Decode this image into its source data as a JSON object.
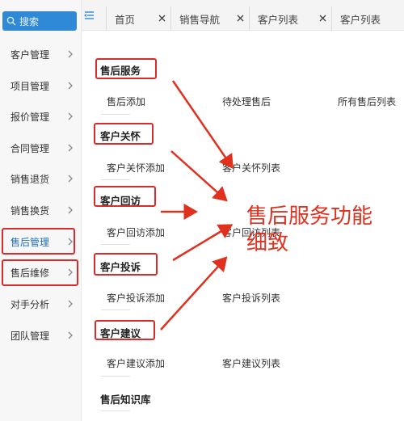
{
  "search": {
    "placeholder": "搜索"
  },
  "sidebar": {
    "items": [
      {
        "label": "客户管理"
      },
      {
        "label": "项目管理"
      },
      {
        "label": "报价管理"
      },
      {
        "label": "合同管理"
      },
      {
        "label": "销售退货"
      },
      {
        "label": "销售换货"
      },
      {
        "label": "售后管理"
      },
      {
        "label": "售后维修"
      },
      {
        "label": "对手分析"
      },
      {
        "label": "团队管理"
      }
    ]
  },
  "tabs": [
    {
      "label": "首页"
    },
    {
      "label": "销售导航"
    },
    {
      "label": "客户列表"
    },
    {
      "label": "客户列表"
    }
  ],
  "sections": [
    {
      "title": "售后服务",
      "items": [
        "售后添加",
        "待处理售后",
        "所有售后列表"
      ]
    },
    {
      "title": "客户关怀",
      "items": [
        "客户关怀添加",
        "客户关怀列表"
      ]
    },
    {
      "title": "客户回访",
      "items": [
        "客户回访添加",
        "客户回访列表"
      ]
    },
    {
      "title": "客户投诉",
      "items": [
        "客户投诉添加",
        "客户投诉列表"
      ]
    },
    {
      "title": "客户建议",
      "items": [
        "客户建议添加",
        "客户建议列表"
      ]
    },
    {
      "title": "售后知识库",
      "items": []
    }
  ],
  "annotation": {
    "line1": "售后服务功能",
    "line2": "细致"
  },
  "colors": {
    "accent": "#2f89d6",
    "annotation": "#e0301e"
  }
}
